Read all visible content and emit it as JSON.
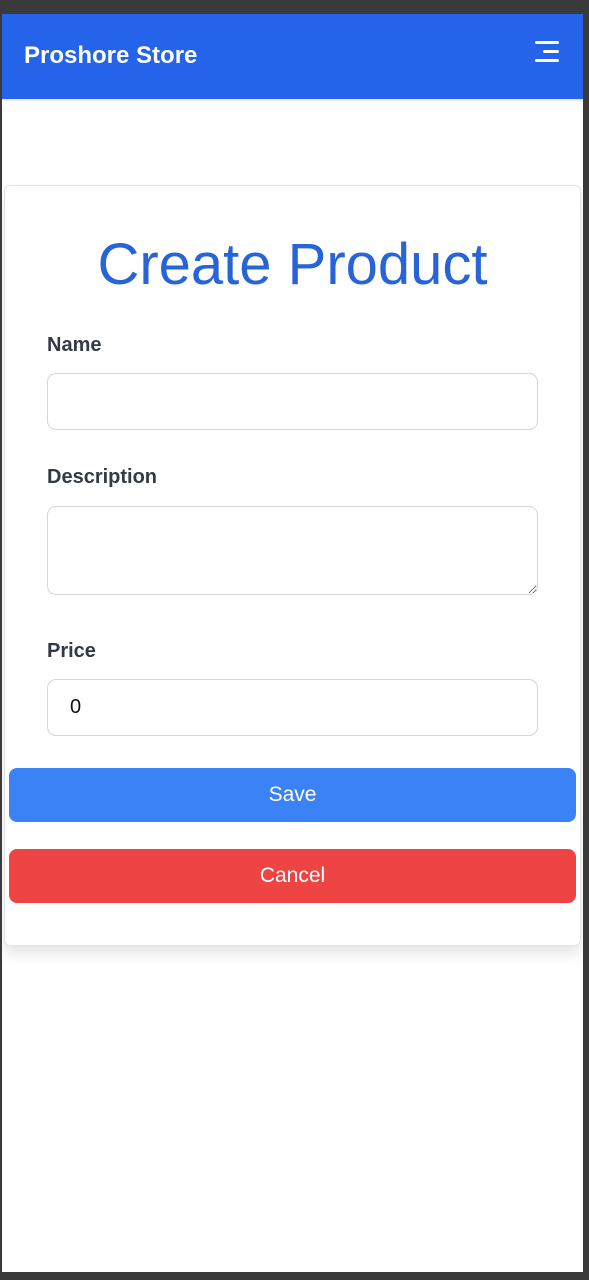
{
  "navbar": {
    "brand": "Proshore Store",
    "menu_icon": "hamburger-menu-icon",
    "color": "#2563eb"
  },
  "form": {
    "title": "Create Product",
    "name_label": "Name",
    "name_value": "",
    "description_label": "Description",
    "description_value": "",
    "price_label": "Price",
    "price_value": "0",
    "save_label": "Save",
    "save_color": "#3b82f6",
    "cancel_label": "Cancel",
    "cancel_color": "#ef4444"
  }
}
